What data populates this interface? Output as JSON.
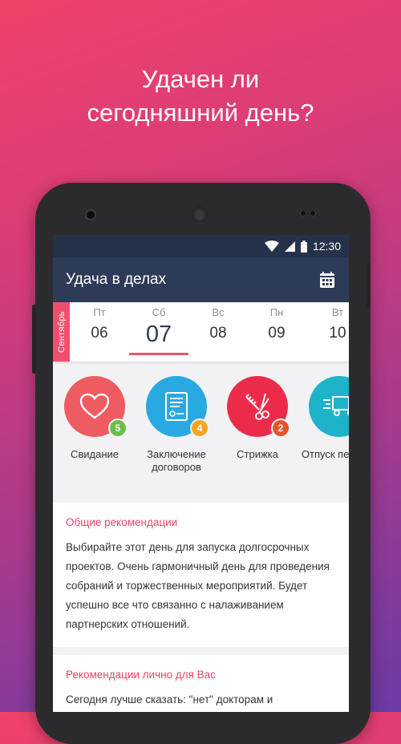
{
  "headline": {
    "line1": "Удачен ли",
    "line2": "сегодняшний день?"
  },
  "status_bar": {
    "time": "12:30",
    "icons": [
      "wifi-icon",
      "signal-icon",
      "battery-icon"
    ]
  },
  "app_bar": {
    "title": "Удача в делах",
    "action_icon": "calendar-icon"
  },
  "calendar": {
    "month": "Сентябрь",
    "days": [
      {
        "dow": "Пт",
        "num": "06"
      },
      {
        "dow": "Сб",
        "num": "07",
        "selected": true
      },
      {
        "dow": "Вс",
        "num": "08"
      },
      {
        "dow": "Пн",
        "num": "09"
      },
      {
        "dow": "Вт",
        "num": "10"
      }
    ]
  },
  "categories": [
    {
      "label": "Свидание",
      "badge": "5",
      "color": "#ee5b60",
      "badge_color": "#6cc04a",
      "icon": "heart-icon"
    },
    {
      "label": "Заключение договоров",
      "badge": "4",
      "color": "#29a9e1",
      "badge_color": "#f5a623",
      "icon": "contract-icon"
    },
    {
      "label": "Стрижка",
      "badge": "2",
      "color": "#ec2b4b",
      "badge_color": "#e2542a",
      "icon": "scissors-comb-icon"
    },
    {
      "label": "Отпуск переезд",
      "badge": "",
      "color": "#1fb3c9",
      "badge_color": "",
      "icon": "truck-icon"
    }
  ],
  "general": {
    "title": "Общие рекомендации",
    "text": "Выбирайте этот день для запуска долгосрочных проектов. Очень гармоничный день для проведения собраний и торжественных мероприятий. Будет успешно все что связанно с налаживанием партнерских отношений."
  },
  "personal": {
    "title": "Рекомендации лично для Вас",
    "text": "Сегодня лучше сказать: \"нет\" докторам и"
  }
}
